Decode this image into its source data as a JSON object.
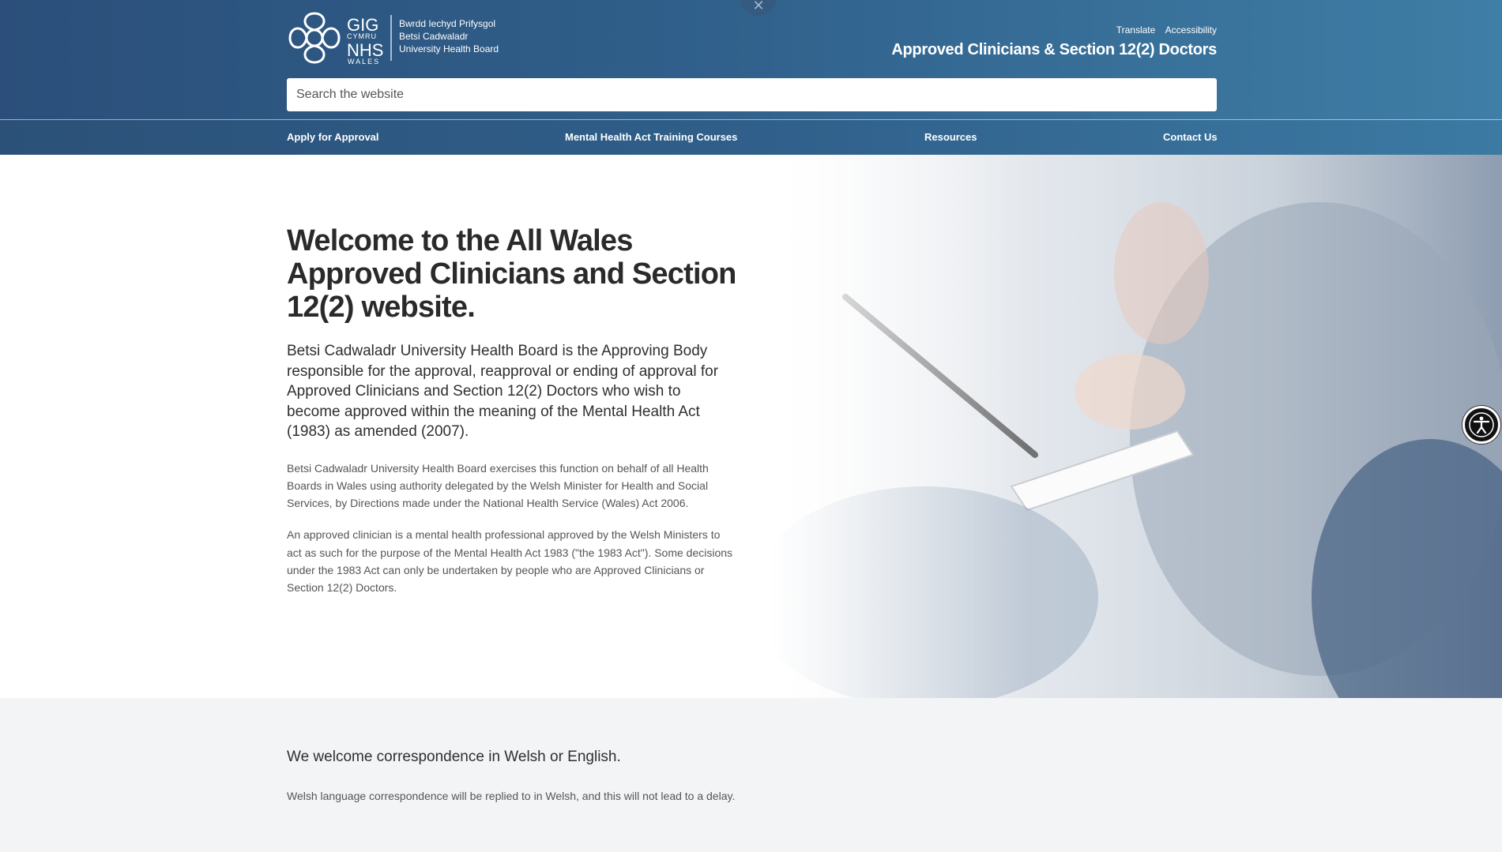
{
  "header": {
    "logo": {
      "gig": "GIG",
      "cymru": "CYMRU",
      "nhs": "NHS",
      "wales": "WALES",
      "line1": "Bwrdd Iechyd Prifysgol",
      "line2": "Betsi Cadwaladr",
      "line3": "University Health Board"
    },
    "links": {
      "translate": "Translate",
      "accessibility": "Accessibility"
    },
    "title": "Approved Clinicians & Section 12(2) Doctors",
    "search_placeholder": "Search the website",
    "close_icon": "✕"
  },
  "nav": {
    "items": [
      {
        "label": "Apply for Approval"
      },
      {
        "label": "Mental Health Act Training Courses"
      },
      {
        "label": "Resources"
      },
      {
        "label": "Contact Us"
      }
    ]
  },
  "hero": {
    "heading": "Welcome to the All Wales Approved Clinicians and Section 12(2) website.",
    "lead": "Betsi Cadwaladr University Health Board is the Approving Body responsible for the approval, reapproval or ending of approval for Approved Clinicians and Section 12(2) Doctors who wish to become approved within the meaning of the Mental Health Act (1983) as amended (2007).",
    "para1": "Betsi Cadwaladr University Health Board exercises this function on behalf of all Health Boards in Wales using authority delegated by the Welsh Minister for Health and Social Services, by Directions made under the National Health Service (Wales) Act 2006.",
    "para2": "An approved clinician is a mental health professional approved by the Welsh Ministers to act as such for the purpose of the Mental Health Act 1983 (\"the 1983 Act\"). Some decisions under the 1983 Act can only be undertaken by people who are Approved Clinicians or Section 12(2) Doctors."
  },
  "welsh": {
    "title": "We welcome correspondence in Welsh or English.",
    "text": "Welsh language correspondence will be replied to in Welsh, and this will not lead to a delay."
  },
  "colors": {
    "header_start": "#2b4f7a",
    "header_end": "#3f7ea6",
    "page_bg": "#f3f4f6"
  },
  "icons": {
    "close": "close-icon",
    "logo": "nhs-wales-knot-logo",
    "accessibility": "accessibility-person-icon"
  }
}
